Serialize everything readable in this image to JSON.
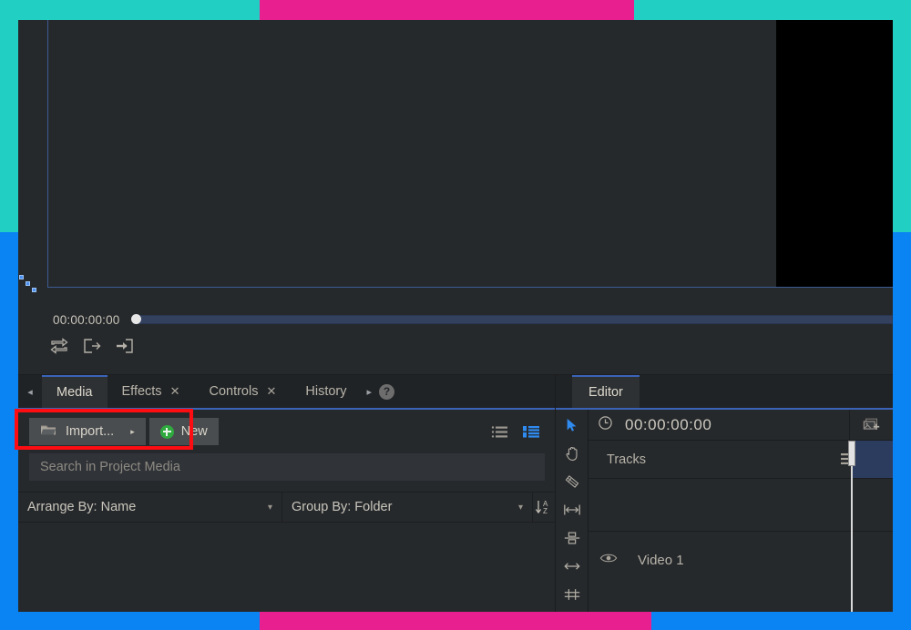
{
  "colors": {
    "highlight_teal": "#21d0c3",
    "highlight_pink": "#e81f8f",
    "highlight_blue": "#0b84f3",
    "annotation_red": "#fd0d12",
    "panel_bg": "#26292c",
    "tab_accent": "#3a63b8",
    "new_green": "#2faa3f"
  },
  "preview": {
    "timecode": "00:00:00:00",
    "transport_buttons": [
      {
        "name": "loop-playback-icon"
      },
      {
        "name": "export-frame-icon"
      },
      {
        "name": "insert-to-timeline-icon"
      }
    ],
    "resize_handle": "resize-grip-icon"
  },
  "media_panel": {
    "scroll_left_arrow": "◂",
    "tabs": [
      {
        "label": "Media",
        "closable": false,
        "active": true
      },
      {
        "label": "Effects",
        "closable": true,
        "active": false
      },
      {
        "label": "Controls",
        "closable": true,
        "active": false
      },
      {
        "label": "History",
        "closable": false,
        "active": false
      }
    ],
    "close_glyph": "✕",
    "scroll_right_arrow": "▸",
    "help_label": "?",
    "toolbar": {
      "import_label": "Import...",
      "import_caret": "▸",
      "new_label": "New",
      "view_list_icon": "list-view-icon",
      "view_detail_icon": "detail-view-icon"
    },
    "search": {
      "placeholder": "Search in Project Media",
      "value": ""
    },
    "sort": {
      "arrange_by": "Arrange By: Name",
      "group_by": "Group By: Folder",
      "caret": "▾",
      "sort_direction_icon": "sort-a-z-icon"
    }
  },
  "editor_panel": {
    "tabs": [
      {
        "label": "Editor",
        "active": true
      }
    ],
    "tools": [
      {
        "name": "selection-tool-icon",
        "active": true
      },
      {
        "name": "hand-tool-icon",
        "active": false
      },
      {
        "name": "razor-tool-icon",
        "active": false
      },
      {
        "name": "trim-tool-icon",
        "active": false
      },
      {
        "name": "slip-tool-icon",
        "active": false
      },
      {
        "name": "slide-tool-icon",
        "active": false
      },
      {
        "name": "snap-tool-icon",
        "active": false
      }
    ],
    "timeline": {
      "clock_icon": "clock-icon",
      "timecode": "00:00:00:00",
      "add_media_icon": "add-media-icon",
      "tracks_label": "Tracks",
      "tracks_menu_icon": "hamburger-menu-icon",
      "track_rows": [
        {
          "label": "Video 1",
          "visibility_icon": "eye-icon"
        }
      ]
    }
  }
}
